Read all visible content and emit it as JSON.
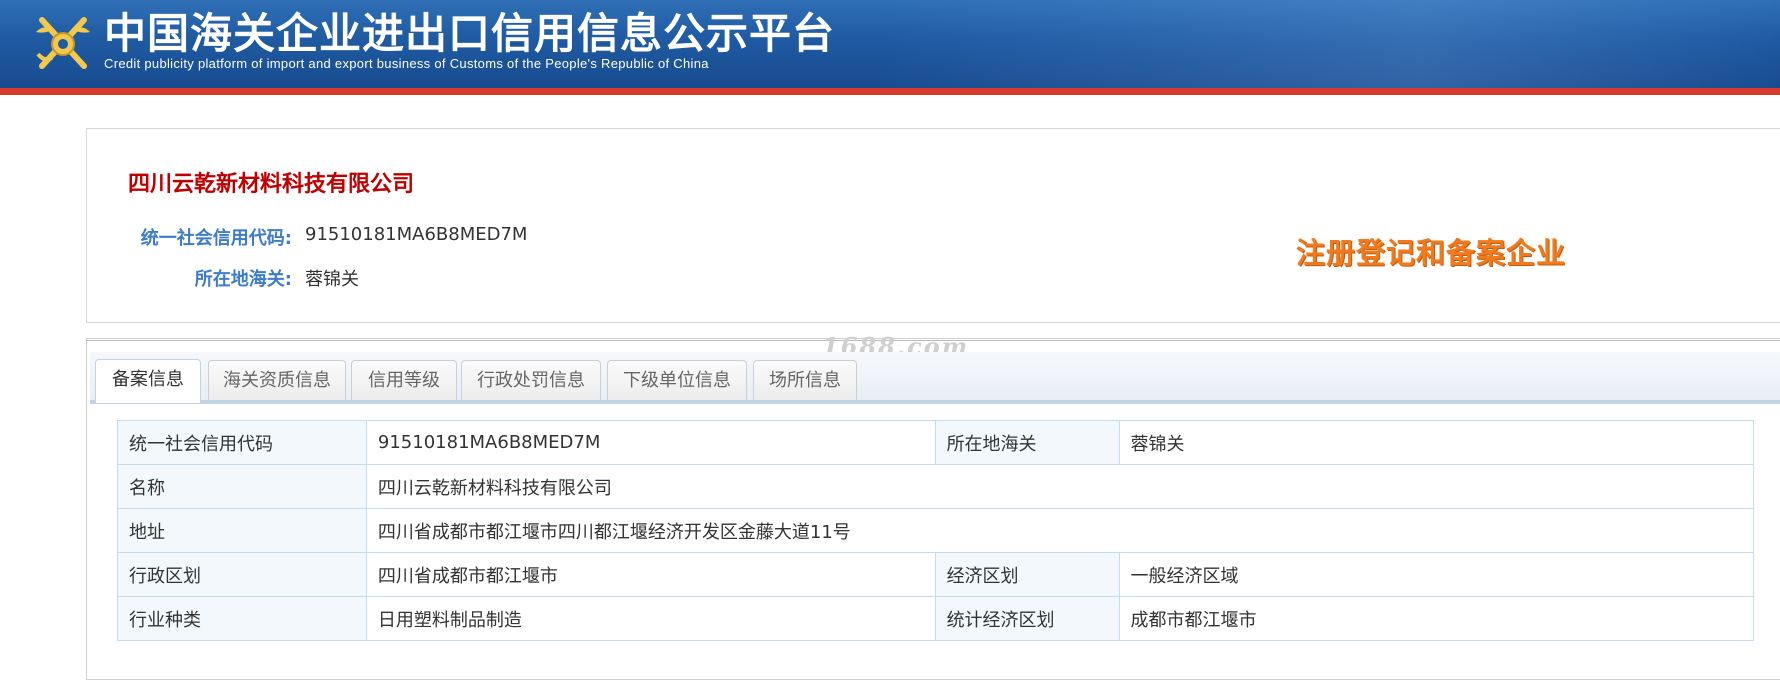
{
  "header": {
    "title_cn": "中国海关企业进出口信用信息公示平台",
    "title_en": "Credit publicity platform of import and export business of Customs of the People's Republic of China",
    "brand_blue": "#1f5aa2",
    "accent_red": "#d83a2b"
  },
  "company": {
    "name": "四川云乾新材料科技有限公司",
    "credit_code_label": "统一社会信用代码:",
    "credit_code": "91510181MA6B8MED7M",
    "customs_label": "所在地海关:",
    "customs": "蓉锦关",
    "badge": "注册登记和备案企业",
    "name_color": "#c00000",
    "label_color": "#3d7cc9",
    "badge_color": "#f07a1e"
  },
  "watermark": "1688.com",
  "tabs": [
    {
      "label": "备案信息",
      "active": true
    },
    {
      "label": "海关资质信息",
      "active": false
    },
    {
      "label": "信用等级",
      "active": false
    },
    {
      "label": "行政处罚信息",
      "active": false
    },
    {
      "label": "下级单位信息",
      "active": false
    },
    {
      "label": "场所信息",
      "active": false
    }
  ],
  "table": {
    "rows": [
      [
        "统一社会信用代码",
        "91510181MA6B8MED7M",
        "所在地海关",
        "蓉锦关"
      ],
      [
        "名称",
        "四川云乾新材料科技有限公司"
      ],
      [
        "地址",
        "四川省成都市都江堰市四川都江堰经济开发区金藤大道11号"
      ],
      [
        "行政区划",
        "四川省成都市都江堰市",
        "经济区划",
        "一般经济区域"
      ],
      [
        "行业种类",
        "日用塑料制品制造",
        "统计经济区划",
        "成都市都江堰市"
      ]
    ]
  }
}
